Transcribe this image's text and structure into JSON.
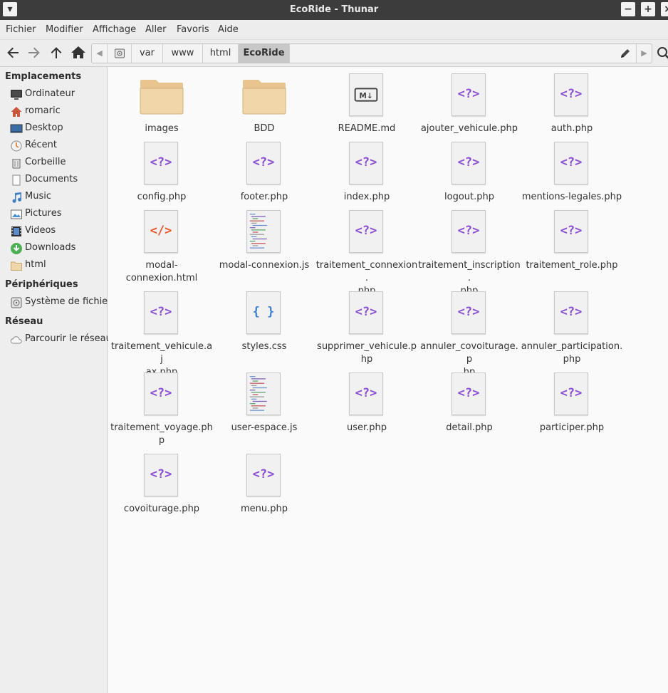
{
  "window": {
    "title": "EcoRide - Thunar",
    "controls": {
      "menu": "▾",
      "minimize": "−",
      "maximize": "+",
      "close": "×"
    }
  },
  "menubar": [
    "Fichier",
    "Modifier",
    "Affichage",
    "Aller",
    "Favoris",
    "Aide"
  ],
  "toolbar": {
    "path": [
      "var",
      "www",
      "html",
      "EcoRide"
    ],
    "active_crumb": "EcoRide"
  },
  "sidebar": {
    "sections": [
      {
        "title": "Emplacements",
        "items": [
          {
            "label": "Ordinateur",
            "icon": "computer-icon"
          },
          {
            "label": "romaric",
            "icon": "home-icon"
          },
          {
            "label": "Desktop",
            "icon": "desktop-icon"
          },
          {
            "label": "Récent",
            "icon": "recent-icon"
          },
          {
            "label": "Corbeille",
            "icon": "trash-icon"
          },
          {
            "label": "Documents",
            "icon": "documents-icon"
          },
          {
            "label": "Music",
            "icon": "music-icon"
          },
          {
            "label": "Pictures",
            "icon": "pictures-icon"
          },
          {
            "label": "Videos",
            "icon": "videos-icon"
          },
          {
            "label": "Downloads",
            "icon": "downloads-icon"
          },
          {
            "label": "html",
            "icon": "folder-icon"
          }
        ]
      },
      {
        "title": "Périphériques",
        "items": [
          {
            "label": "Système de fichiers",
            "icon": "drive-icon"
          }
        ]
      },
      {
        "title": "Réseau",
        "items": [
          {
            "label": "Parcourir le réseau",
            "icon": "network-icon"
          }
        ]
      }
    ]
  },
  "files": [
    {
      "name": "images",
      "type": "folder"
    },
    {
      "name": "BDD",
      "type": "folder"
    },
    {
      "name": "README.md",
      "type": "markdown"
    },
    {
      "name": "ajouter_vehicule.php",
      "type": "php"
    },
    {
      "name": "auth.php",
      "type": "php"
    },
    {
      "name": "config.php",
      "type": "php"
    },
    {
      "name": "footer.php",
      "type": "php"
    },
    {
      "name": "index.php",
      "type": "php"
    },
    {
      "name": "logout.php",
      "type": "php"
    },
    {
      "name": "mentions-legales.php",
      "type": "php"
    },
    {
      "name": "modal-connexion.html",
      "type": "html"
    },
    {
      "name": "modal-connexion.js",
      "type": "js"
    },
    {
      "name": "traitement_connexion.php",
      "type": "php",
      "lines": [
        "traitement_connexion.",
        "php"
      ]
    },
    {
      "name": "traitement_inscription.php",
      "type": "php",
      "lines": [
        "traitement_inscription.",
        "php"
      ]
    },
    {
      "name": "traitement_role.php",
      "type": "php"
    },
    {
      "name": "traitement_vehicule.ajax.php",
      "type": "php",
      "lines": [
        "traitement_vehicule.aj",
        "ax.php"
      ]
    },
    {
      "name": "styles.css",
      "type": "css"
    },
    {
      "name": "supprimer_vehicule.php",
      "type": "php",
      "lines": [
        "supprimer_vehicule.p",
        "hp"
      ]
    },
    {
      "name": "annuler_covoiturage.php",
      "type": "php",
      "lines": [
        "annuler_covoiturage.p",
        "hp"
      ]
    },
    {
      "name": "annuler_participation.php",
      "type": "php",
      "lines": [
        "annuler_participation.",
        "php"
      ]
    },
    {
      "name": "traitement_voyage.php",
      "type": "php",
      "lines": [
        "traitement_voyage.ph",
        "p"
      ]
    },
    {
      "name": "user-espace.js",
      "type": "js"
    },
    {
      "name": "user.php",
      "type": "php"
    },
    {
      "name": "detail.php",
      "type": "php"
    },
    {
      "name": "participer.php",
      "type": "php"
    },
    {
      "name": "covoiturage.php",
      "type": "php"
    },
    {
      "name": "menu.php",
      "type": "php"
    }
  ],
  "glyphs": {
    "php": "<?>",
    "html": "</>",
    "css": "{ }",
    "markdown": "M↓"
  },
  "colors": {
    "php": "#8a4fd6",
    "html": "#e8562a",
    "css": "#3b7fd4",
    "folder": "#f0d6a8"
  }
}
